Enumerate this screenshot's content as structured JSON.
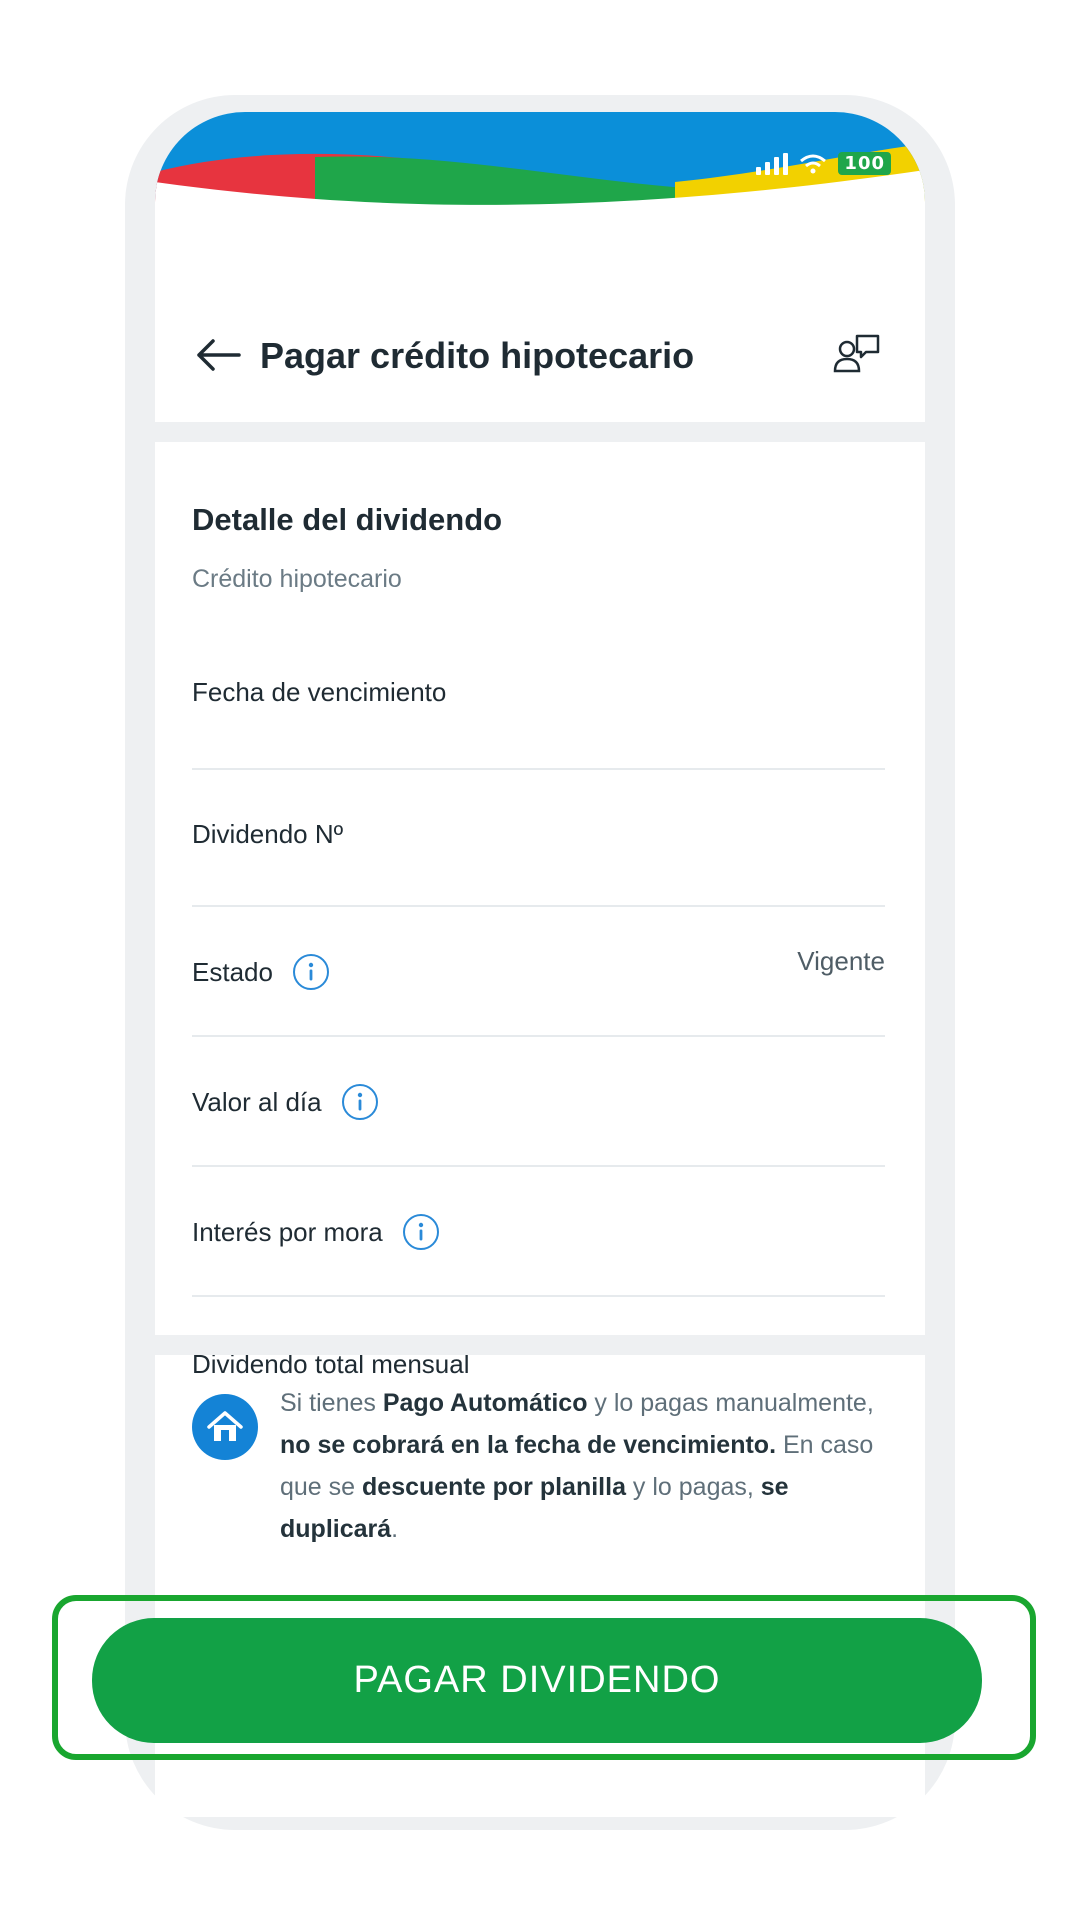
{
  "status_bar": {
    "battery": "100"
  },
  "header": {
    "title": "Pagar crédito hipotecario"
  },
  "detail": {
    "title": "Detalle del dividendo",
    "subtitle": "Crédito hipotecario",
    "rows": [
      {
        "label": "Fecha de vencimiento",
        "value": ""
      },
      {
        "label": "Dividendo Nº",
        "value": ""
      },
      {
        "label": "Estado",
        "value": "Vigente"
      },
      {
        "label": "Valor al día",
        "value": ""
      },
      {
        "label": "Interés por mora",
        "value": ""
      },
      {
        "label": "Dividendo total mensual",
        "value": ""
      }
    ]
  },
  "notice": {
    "t1": "Si tienes ",
    "b1": "Pago Automático",
    "t2": " y lo pagas manualmente, ",
    "b2": "no se cobrará en la fecha de vencimiento.",
    "t3": " En caso que se ",
    "b3": "descuente por planilla",
    "t4": " y lo pagas, ",
    "b4": "se duplicará",
    "t5": "."
  },
  "actions": {
    "pay_label": "PAGAR DIVIDENDO"
  },
  "colors": {
    "primary_green": "#12a146",
    "info_blue": "#2a8ad8",
    "highlight_green": "#19a62f"
  }
}
